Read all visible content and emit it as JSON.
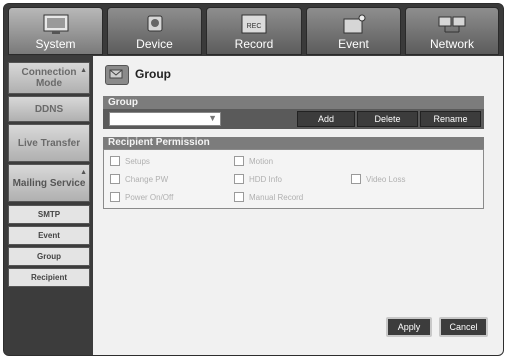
{
  "tabs": [
    {
      "label": "System",
      "icon": "system-icon"
    },
    {
      "label": "Device",
      "icon": "device-icon"
    },
    {
      "label": "Record",
      "icon": "record-icon",
      "badge": "REC"
    },
    {
      "label": "Event",
      "icon": "event-icon"
    },
    {
      "label": "Network",
      "icon": "network-icon"
    }
  ],
  "sidebar": {
    "items": [
      {
        "label": "Connection Mode"
      },
      {
        "label": "DDNS"
      },
      {
        "label": "Live Transfer"
      },
      {
        "label": "Mailing Service"
      }
    ],
    "subitems": [
      {
        "label": "SMTP"
      },
      {
        "label": "Event"
      },
      {
        "label": "Group"
      },
      {
        "label": "Recipient"
      }
    ]
  },
  "main": {
    "title": "Group",
    "group_label": "Group",
    "group_value": "",
    "buttons": {
      "add": "Add",
      "delete": "Delete",
      "rename": "Rename"
    },
    "permission_label": "Recipient Permission",
    "permissions": [
      {
        "label": "Setups"
      },
      {
        "label": "Motion"
      },
      {
        "label": "Change PW"
      },
      {
        "label": "HDD Info"
      },
      {
        "label": "Video Loss"
      },
      {
        "label": "Power On/Off"
      },
      {
        "label": "Manual Record"
      }
    ]
  },
  "footer": {
    "apply": "Apply",
    "cancel": "Cancel"
  },
  "colors": {
    "panel_header": "#7c7c7c",
    "button": "#3c3c3c",
    "sidebar": "#3c3c3c"
  }
}
